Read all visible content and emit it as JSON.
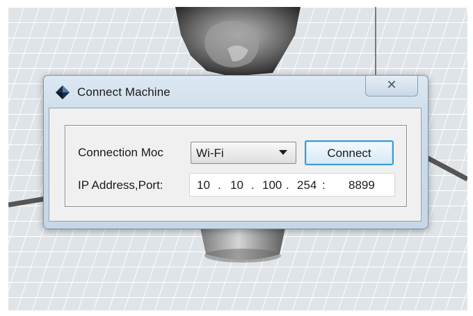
{
  "dialog": {
    "title": "Connect Machine",
    "close_symbol": "✕",
    "app_icon": "diamond-app-icon"
  },
  "form": {
    "connection_mode_label": "Connection Moc",
    "connection_mode_value": "Wi-Fi",
    "connect_button": "Connect",
    "ip_label": "IP Address,Port:",
    "ip": {
      "octet1": "10",
      "octet2": "10",
      "octet3": "100",
      "octet4": "254",
      "dot": ".",
      "colon": ":",
      "port": "8899"
    }
  },
  "colors": {
    "focus_border": "#3c9bd6",
    "titlebar": "#cddcea",
    "viewport_floor": "#d9dee3"
  }
}
